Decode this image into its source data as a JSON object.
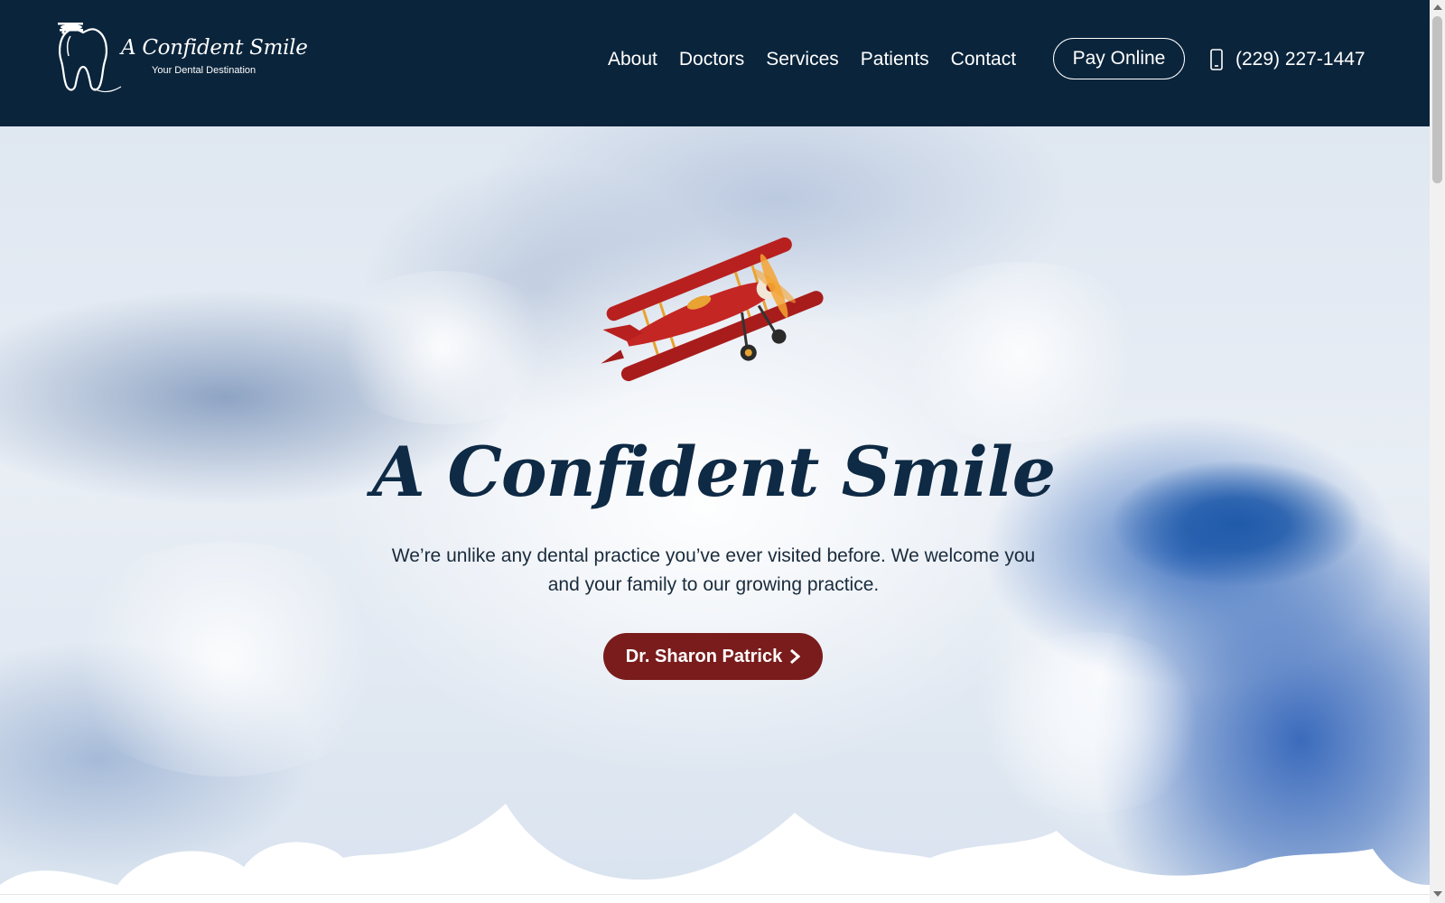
{
  "header": {
    "logo_title": "A Confident Smile",
    "logo_subtitle": "Your Dental Destination",
    "nav": [
      {
        "label": "About"
      },
      {
        "label": "Doctors"
      },
      {
        "label": "Services"
      },
      {
        "label": "Patients"
      },
      {
        "label": "Contact"
      }
    ],
    "pay_button": "Pay Online",
    "phone": "(229) 227-1447",
    "phone_icon": "mobile-phone-icon"
  },
  "hero": {
    "title": "A Confident Smile",
    "text": "We’re unlike any dental practice you’ve ever visited before. We welcome you and your family to our growing practice.",
    "cta_label": "Dr. Sharon Patrick",
    "cta_icon": "chevron-right-icon",
    "illustration": "red-biplane-illustration"
  },
  "colors": {
    "header_bg": "#0a243b",
    "title_color": "#0e2a45",
    "cta_bg": "#7a1c1c",
    "white": "#ffffff"
  }
}
